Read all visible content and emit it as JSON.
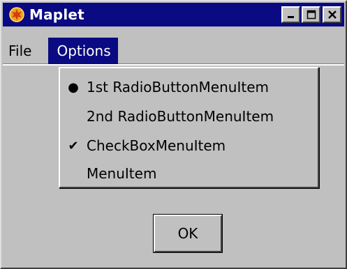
{
  "window": {
    "title": "Maplet",
    "icon": "maple-leaf-icon",
    "controls": [
      "minimize-icon",
      "maximize-icon",
      "close-icon"
    ]
  },
  "menubar": {
    "items": [
      {
        "label": "File",
        "active": false
      },
      {
        "label": "Options",
        "active": true
      }
    ]
  },
  "dropdown": {
    "items": [
      {
        "label": "1st RadioButtonMenuItem",
        "mark": "●",
        "type": "radio",
        "selected": true
      },
      {
        "label": "2nd RadioButtonMenuItem",
        "mark": "",
        "type": "radio",
        "selected": false
      },
      {
        "label": "CheckBoxMenuItem",
        "mark": "✔",
        "type": "checkbox",
        "checked": true
      },
      {
        "label": "MenuItem",
        "mark": "",
        "type": "item"
      }
    ]
  },
  "ok_button": {
    "label": "OK"
  },
  "colors": {
    "title_bar": "#0a0a82",
    "face": "#c0c0c0",
    "highlight": "#ffffff",
    "shadow": "#404040"
  }
}
